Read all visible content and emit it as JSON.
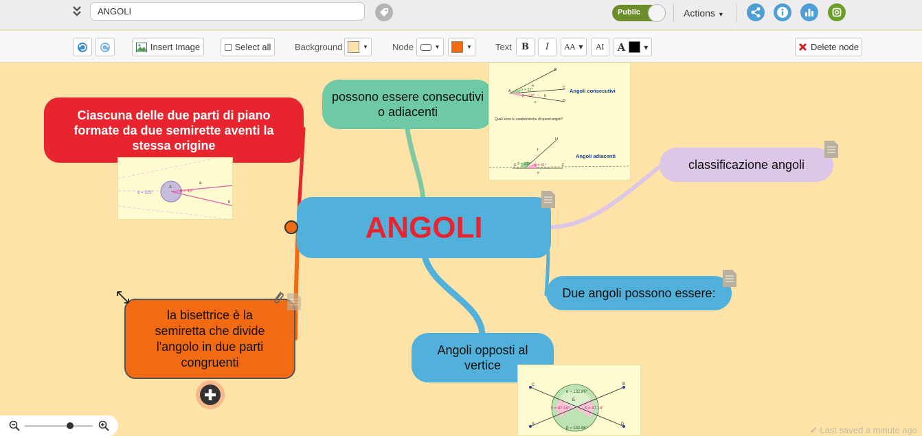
{
  "header": {
    "map_title": "ANGOLI",
    "public_label": "Public",
    "actions_label": "Actions"
  },
  "toolbar": {
    "insert_image": "Insert Image",
    "select_all": "Select all",
    "background_label": "Background",
    "node_label": "Node",
    "text_label": "Text",
    "bold": "B",
    "italic": "I",
    "font_size": "AA",
    "capitalize": "AI",
    "text_color_glyph": "A",
    "delete_node": "Delete node"
  },
  "colors": {
    "canvas_bg": "#fde3a7",
    "background_swatch": "#fde3a7",
    "node_fill_swatch": "#ffffff",
    "node_border_swatch": "#f26a11",
    "text_color_swatch": "#000000",
    "central_node": "#52b1da",
    "central_text": "#e8242f"
  },
  "map": {
    "central": "ANGOLI",
    "nodes": {
      "definition": "Ciascuna delle due parti di piano formate da due semirette aventi la stessa origine",
      "consecutive": "possono essere consecutivi o adiacenti",
      "classification": "classificazione angoli",
      "two_angles": "Due angoli possono essere:",
      "opposite": "Angoli opposti al vertice",
      "bisector": "la bisettrice è la semiretta che divide l'angolo in due parti congruenti"
    },
    "images": {
      "definition_img": {
        "alpha": "α = 325°",
        "beta": "β = 35°",
        "vertex": "A",
        "a": "a",
        "b": "b"
      },
      "consecutive_img": {
        "title1": "Angoli consecutivi",
        "question": "Quali sono le caratteristiche di questi angoli?",
        "title2": "Angoli adiacenti",
        "alpha": "α = 22°",
        "beta": "β = 18°",
        "gamma": "γ = 41°",
        "delta": "δ = 139°",
        "A": "A",
        "B": "B",
        "C": "C",
        "D": "D",
        "E": "E",
        "F": "F",
        "H": "H",
        "a": "a",
        "b": "b",
        "c": "c",
        "e": "e",
        "f": "f"
      },
      "opposite_img": {
        "alpha": "α = 132.86°",
        "beta": "β = 132.86°",
        "gamma": "γ = 47.14°",
        "delta": "δ = 47.14°",
        "A": "A",
        "B": "B",
        "C": "C",
        "D": "D",
        "E": "E"
      }
    }
  },
  "footer": {
    "saved_status": "Last saved a minute ago"
  }
}
